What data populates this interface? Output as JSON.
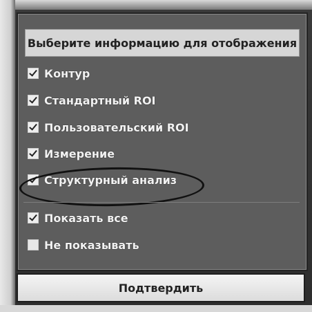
{
  "dialog": {
    "title": "Выберите информацию для отображения",
    "options": [
      {
        "label": "Контур",
        "checked": true
      },
      {
        "label": "Стандартный ROI",
        "checked": true
      },
      {
        "label": "Пользовательский ROI",
        "checked": true
      },
      {
        "label": "Измерение",
        "checked": true
      },
      {
        "label": "Структурный анализ",
        "checked": true
      }
    ],
    "show_all": {
      "label": "Показать все",
      "checked": true
    },
    "show_none": {
      "label": "Не показывать",
      "checked": false
    },
    "confirm_label": "Подтвердить"
  }
}
